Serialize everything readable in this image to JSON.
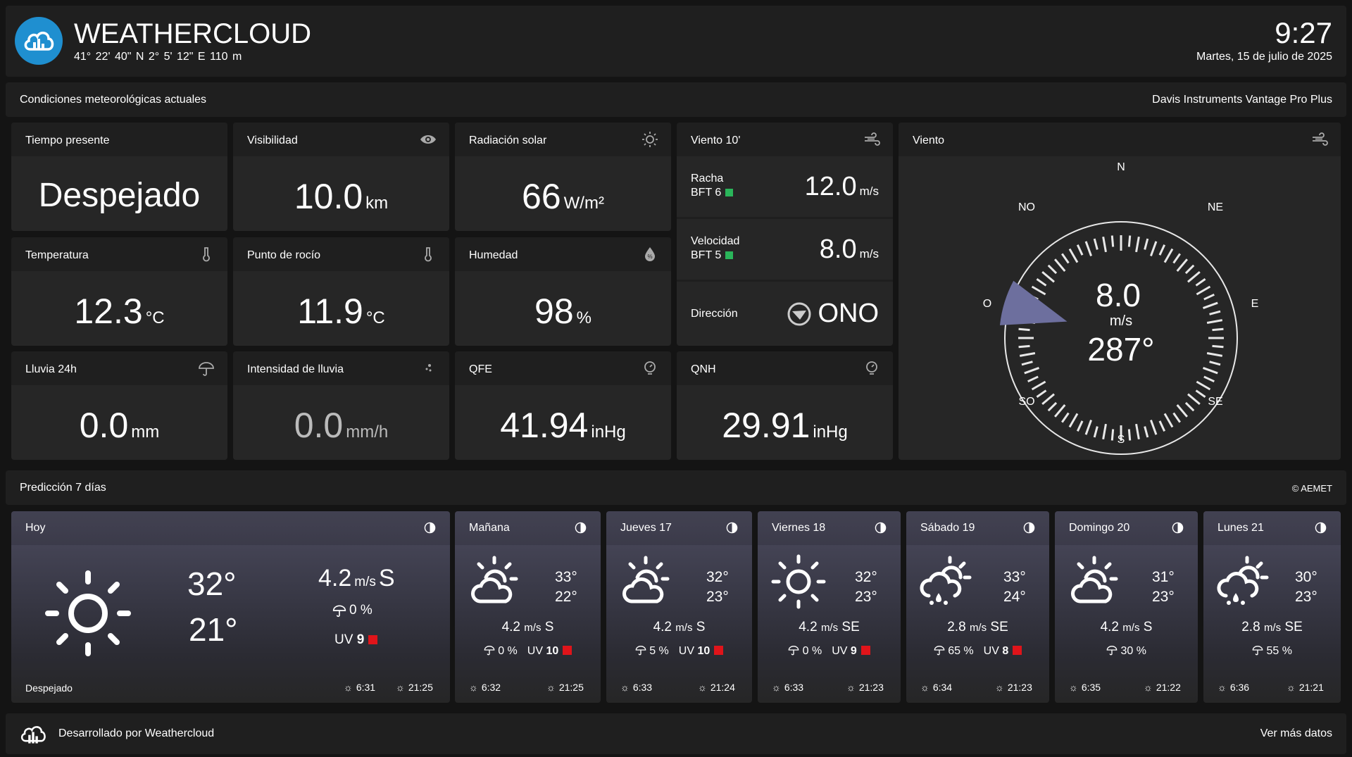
{
  "header": {
    "brand": "WEATHERCLOUD",
    "coords": "41° 22' 40\" N   2° 5' 12\" E   110 m",
    "time": "9:27",
    "date": "Martes, 15 de julio de 2025"
  },
  "current": {
    "title": "Condiciones meteorológicas actuales",
    "station": "Davis Instruments Vantage Pro Plus",
    "tiempo": {
      "label": "Tiempo presente",
      "value": "Despejado"
    },
    "visibilidad": {
      "label": "Visibilidad",
      "value": "10.0",
      "unit": "km",
      "icon": "eye-icon"
    },
    "radiacion": {
      "label": "Radiación solar",
      "value": "66",
      "unit": "W/m²",
      "icon": "sun-icon"
    },
    "temperatura": {
      "label": "Temperatura",
      "value": "12.3",
      "unit": "°C",
      "icon": "thermometer-icon"
    },
    "rocio": {
      "label": "Punto de rocío",
      "value": "11.9",
      "unit": "°C",
      "icon": "thermometer-icon"
    },
    "humedad": {
      "label": "Humedad",
      "value": "98",
      "unit": "%",
      "icon": "humidity-drop-icon"
    },
    "lluvia": {
      "label": "Lluvia 24h",
      "value": "0.0",
      "unit": "mm",
      "icon": "umbrella-icon"
    },
    "intensidad": {
      "label": "Intensidad de lluvia",
      "value": "0.0",
      "unit": "mm/h",
      "icon": "rain-drops-icon"
    },
    "qfe": {
      "label": "QFE",
      "value": "41.94",
      "unit": "inHg",
      "icon": "barometer-icon"
    },
    "qnh": {
      "label": "QNH",
      "value": "29.91",
      "unit": "inHg",
      "icon": "barometer-icon"
    },
    "viento10": {
      "label": "Viento 10'",
      "racha_label": "Racha",
      "racha_bft": "BFT 6",
      "racha_value": "12.0",
      "speed_label": "Velocidad",
      "speed_bft": "BFT 5",
      "speed_value": "8.0",
      "unit": "m/s",
      "dir_label": "Dirección",
      "dir_value": "ONO",
      "bft_color": "#2ab55a"
    },
    "viento": {
      "label": "Viento",
      "speed": "8.0",
      "unit": "m/s",
      "deg": "287°",
      "direction_degrees": 287,
      "cardinals": {
        "n": "N",
        "ne": "NE",
        "e": "E",
        "se": "SE",
        "s": "S",
        "so": "SO",
        "o": "O",
        "no": "NO"
      }
    }
  },
  "forecast": {
    "title": "Predicción 7 días",
    "source": "© AEMET",
    "today": {
      "name": "Hoy",
      "max": "32°",
      "min": "21°",
      "wind_speed": "4.2",
      "wind_unit": "m/s",
      "wind_dir": "S",
      "rain": "0 %",
      "uv_label": "UV",
      "uv": "9",
      "desc": "Despejado",
      "sunrise": "6:31",
      "sunset": "21:25"
    },
    "days": [
      {
        "name": "Mañana",
        "max": "33°",
        "min": "22°",
        "wind": "4.2",
        "unit": "m/s",
        "dir": "S",
        "rain": "0 %",
        "uv_label": "UV",
        "uv": "10",
        "sunrise": "6:32",
        "sunset": "21:25",
        "icon": "partly-cloudy-icon"
      },
      {
        "name": "Jueves 17",
        "max": "32°",
        "min": "23°",
        "wind": "4.2",
        "unit": "m/s",
        "dir": "S",
        "rain": "5 %",
        "uv_label": "UV",
        "uv": "10",
        "sunrise": "6:33",
        "sunset": "21:24",
        "icon": "partly-cloudy-icon"
      },
      {
        "name": "Viernes 18",
        "max": "32°",
        "min": "23°",
        "wind": "4.2",
        "unit": "m/s",
        "dir": "SE",
        "rain": "0 %",
        "uv_label": "UV",
        "uv": "9",
        "sunrise": "6:33",
        "sunset": "21:23",
        "icon": "sun-icon"
      },
      {
        "name": "Sábado 19",
        "max": "33°",
        "min": "24°",
        "wind": "2.8",
        "unit": "m/s",
        "dir": "SE",
        "rain": "65 %",
        "uv_label": "UV",
        "uv": "8",
        "sunrise": "6:34",
        "sunset": "21:23",
        "icon": "cloud-rain-sun-icon"
      },
      {
        "name": "Domingo 20",
        "max": "31°",
        "min": "23°",
        "wind": "4.2",
        "unit": "m/s",
        "dir": "S",
        "rain": "30 %",
        "uv_label": "",
        "uv": "",
        "sunrise": "6:35",
        "sunset": "21:22",
        "icon": "partly-cloudy-icon"
      },
      {
        "name": "Lunes 21",
        "max": "30°",
        "min": "23°",
        "wind": "2.8",
        "unit": "m/s",
        "dir": "SE",
        "rain": "55 %",
        "uv_label": "",
        "uv": "",
        "sunrise": "6:36",
        "sunset": "21:21",
        "icon": "cloud-rain-sun-icon"
      }
    ]
  },
  "footer": {
    "developed": "Desarrollado por Weathercloud",
    "more": "Ver más datos"
  },
  "colors": {
    "accent": "#1f8fd0",
    "uv": "#e0141a",
    "bft": "#2ab55a",
    "wind_sector": "#6d6f9e"
  }
}
